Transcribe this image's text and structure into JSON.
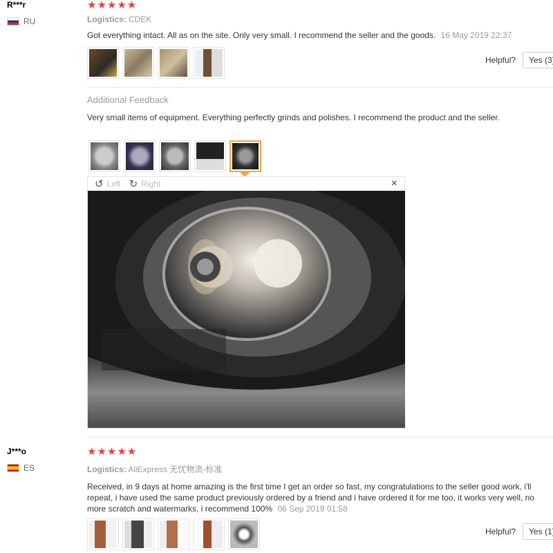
{
  "reviews": [
    {
      "user": "R***r",
      "country": "RU",
      "stars": "★★★★★",
      "logistics_label": "Logistics:",
      "logistics_value": "CDEK",
      "text": "Got everything intact. All as on the site. Only very small. I recommend the seller and the goods.",
      "date": "16 May 2019 22:37",
      "helpful_label": "Helpful?",
      "yes_label": "Yes (3)",
      "additional": {
        "title": "Additional Feedback",
        "text": "Very small items of equipment. Everything perfectly grinds and polishes. I recommend the product and the seller."
      },
      "viewer": {
        "left_label": "Left",
        "right_label": "Right",
        "close": "×"
      }
    },
    {
      "user": "J***o",
      "country": "ES",
      "stars": "★★★★★",
      "logistics_label": "Logistics:",
      "logistics_value": "AliExpress 无忧物流-标准",
      "text": "Received, in 9 days at home amazing is the first time I get an order so fast, my congratulations to the seller good work, i'll repeat, i have used the same product previously ordered by a friend and i have ordered it for me too, it works very well, no more scratch and watermarks, i recommend 100%",
      "date": "06 Sep 2019 01:58",
      "helpful_label": "Helpful?",
      "yes_label": "Yes (1)"
    }
  ],
  "icons": {
    "rotate_left": "↺",
    "rotate_right": "↻"
  }
}
